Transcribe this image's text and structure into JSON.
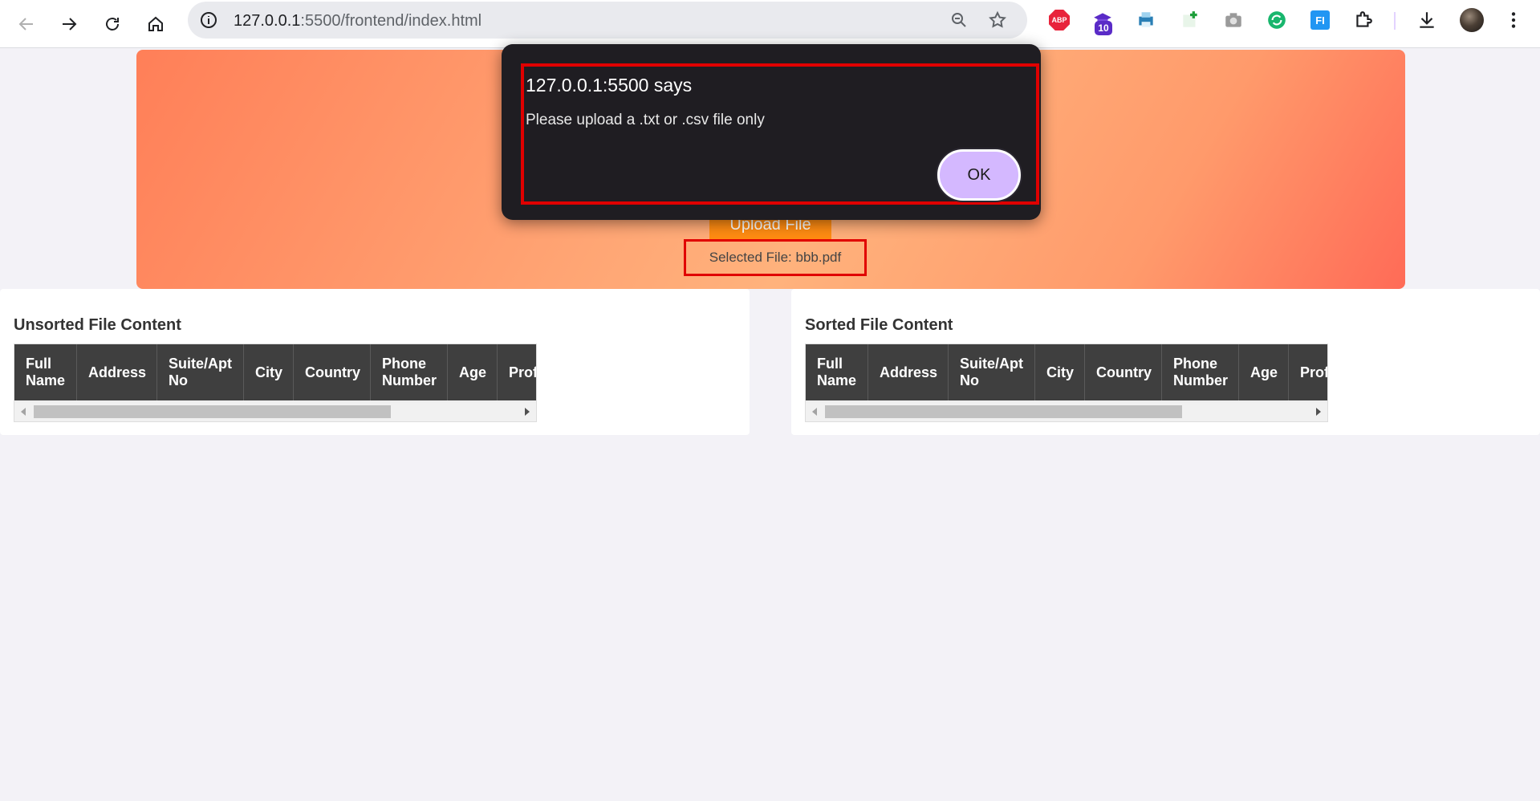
{
  "browser": {
    "url_host": "127.0.0.1",
    "url_path": ":5500/frontend/index.html",
    "extension_badge": "10",
    "abp_label": "ABP",
    "ext_fi_label": "FI"
  },
  "hero": {
    "upload_button_label": "Upload File",
    "selected_file_text": "Selected File: bbb.pdf"
  },
  "unsorted": {
    "title": "Unsorted File Content",
    "columns": [
      "Full Name",
      "Address",
      "Suite/Apt No",
      "City",
      "Country",
      "Phone Number",
      "Age",
      "Prof"
    ]
  },
  "sorted": {
    "title": "Sorted File Content",
    "columns": [
      "Full Name",
      "Address",
      "Suite/Apt No",
      "City",
      "Country",
      "Phone Number",
      "Age",
      "Prof"
    ]
  },
  "alert": {
    "title": "127.0.0.1:5500 says",
    "message": "Please upload a .txt or .csv file only",
    "ok_label": "OK"
  },
  "colors": {
    "accent_orange": "#ff8c12",
    "highlight_red": "#e00000",
    "ok_button": "#d4b8ff",
    "table_header": "#3f3f3f"
  }
}
